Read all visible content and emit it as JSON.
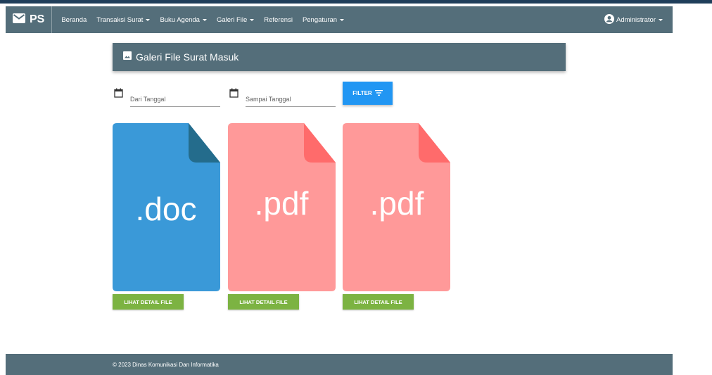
{
  "navbar": {
    "brand": "PS",
    "items": [
      {
        "label": "Beranda",
        "dropdown": false
      },
      {
        "label": "Transaksi Surat",
        "dropdown": true
      },
      {
        "label": "Buku Agenda",
        "dropdown": true
      },
      {
        "label": "Galeri File",
        "dropdown": true
      },
      {
        "label": "Referensi",
        "dropdown": false
      },
      {
        "label": "Pengaturan",
        "dropdown": true
      }
    ],
    "user": "Administrator"
  },
  "page": {
    "title": "Galeri File Surat Masuk"
  },
  "filters": {
    "from_placeholder": "Dari Tanggal",
    "to_placeholder": "Sampai Tanggal",
    "filter_label": "FILTER"
  },
  "files": [
    {
      "ext": ".doc",
      "color": "#3a99d8",
      "fold_color": "#246c8c",
      "button": "LIHAT DETAIL FILE"
    },
    {
      "ext": ".pdf",
      "color": "#ff9999",
      "fold_color": "#ff6b6b",
      "button": "LIHAT DETAIL FILE"
    },
    {
      "ext": ".pdf",
      "color": "#ff9999",
      "fold_color": "#ff6b6b",
      "button": "LIHAT DETAIL FILE"
    }
  ],
  "footer": {
    "text": "© 2023 Dinas Komunikasi Dan Informatika"
  },
  "colors": {
    "primary": "#546e7a",
    "filter_button": "#2196f3",
    "detail_button": "#7cb342"
  }
}
